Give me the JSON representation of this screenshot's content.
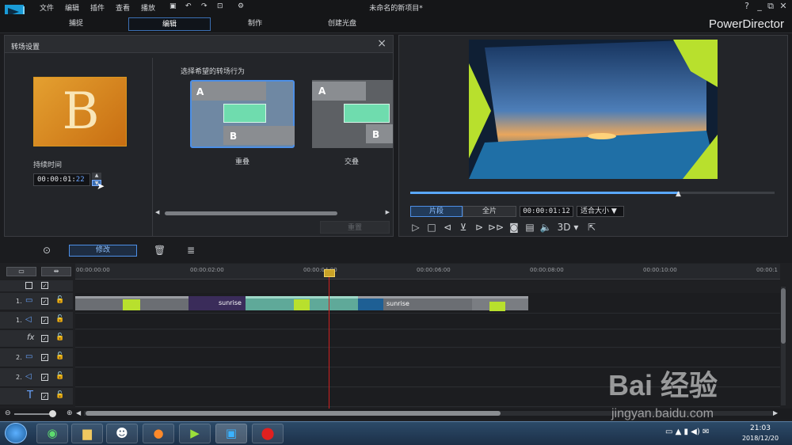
{
  "menu": [
    "文件",
    "编辑",
    "插件",
    "查看",
    "播放"
  ],
  "window_title": "未命名的新项目*",
  "window_controls": [
    "?",
    "_",
    "⧉",
    "✕"
  ],
  "modes": [
    "捕捉",
    "编辑",
    "制作",
    "创建光盘"
  ],
  "brand": "PowerDirector",
  "transition_panel": {
    "title": "转场设置",
    "thumbnail_letter": "B",
    "duration_label": "持续时间",
    "duration_main": "00:00:01:",
    "duration_frames": "22",
    "behavior_label": "选择希望的转场行为",
    "options": [
      {
        "name": "重叠",
        "a": "A",
        "b": "B",
        "selected": true
      },
      {
        "name": "交叠",
        "a": "A",
        "b": "B",
        "selected": false
      }
    ],
    "apply_label": "重置"
  },
  "preview": {
    "clip_label": "片段",
    "full_label": "全片",
    "time": "00:00:01:12",
    "fit_label": "适合大小",
    "three_d": "3D",
    "seek_position": 0.74
  },
  "timeline": {
    "modify_label": "修改",
    "ruler": [
      "00:00:00:00",
      "00:00:02:00",
      "00:00:04:00",
      "00:00:06:00",
      "00:00:08:00",
      "00:00:10:00",
      "00:00:1"
    ],
    "tracks": [
      {
        "num": "1.",
        "icon": "video-track-icon"
      },
      {
        "num": "1.",
        "icon": "audio-track-icon"
      },
      {
        "num": "",
        "icon": "fx-track-icon"
      },
      {
        "num": "2.",
        "icon": "video-track-icon"
      },
      {
        "num": "2.",
        "icon": "audio-track-icon"
      },
      {
        "num": "",
        "icon": "title-track-icon"
      }
    ],
    "clip_names": [
      "sunrise",
      "sunrise"
    ]
  },
  "taskbar": {
    "time": "21:03",
    "date": "2018/12/20"
  },
  "watermark": {
    "brand": "Bai 经验",
    "url": "jingyan.baidu.com"
  },
  "colors": {
    "accent": "#4d8fe6",
    "transition_green": "#6fdcae",
    "thumbnail_orange": "#e4a030"
  }
}
